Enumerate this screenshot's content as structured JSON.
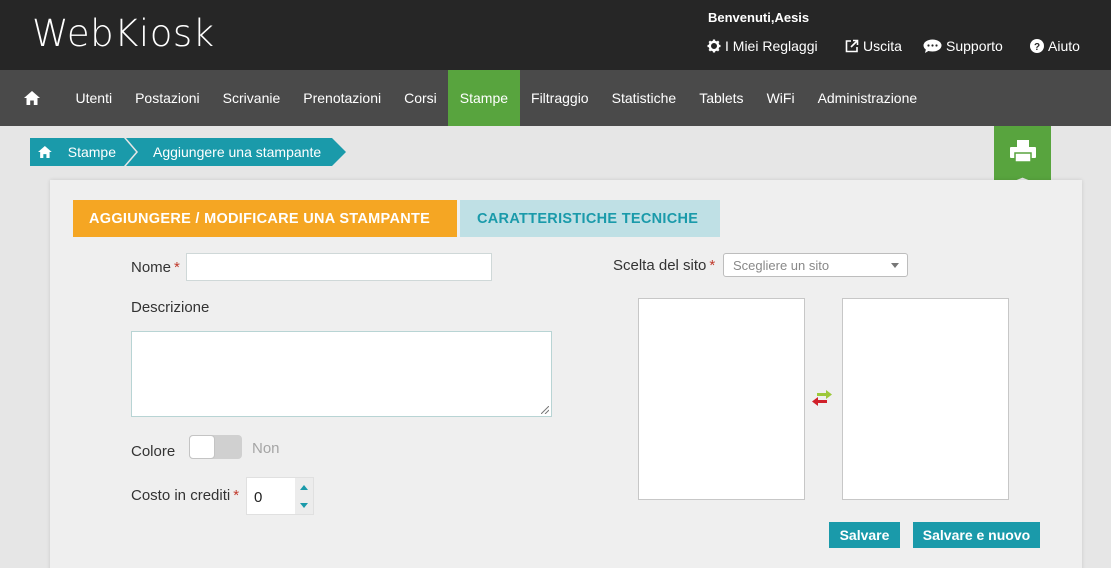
{
  "header": {
    "logo": "WebKiosk",
    "welcome": "Benvenuti,Aesis",
    "links": [
      {
        "label": "I Miei Reglaggi",
        "icon": "gear-icon"
      },
      {
        "label": "Uscita",
        "icon": "external-link-icon"
      },
      {
        "label": "Supporto",
        "icon": "chat-bubble-icon"
      },
      {
        "label": "Aiuto",
        "icon": "question-circle-icon"
      }
    ]
  },
  "nav": {
    "home_icon": "home-icon",
    "items": [
      "Utenti",
      "Postazioni",
      "Scrivanie",
      "Prenotazioni",
      "Corsi",
      "Stampe",
      "Filtraggio",
      "Statistiche",
      "Tablets",
      "WiFi",
      "Administrazione"
    ],
    "active": "Stampe"
  },
  "breadcrumb": {
    "items": [
      "Stampe",
      "Aggiungere una stampante"
    ]
  },
  "page_icon": "printer-icon",
  "tabs": {
    "active": "AGGIUNGERE / MODIFICARE UNA STAMPANTE",
    "inactive": "CARATTERISTICHE TECNICHE"
  },
  "form": {
    "name_label": "Nome",
    "name_value": "",
    "description_label": "Descrizione",
    "description_value": "",
    "color_label": "Colore",
    "color_toggle_text": "Non",
    "cost_label": "Costo in crediti",
    "cost_value": "0",
    "required_mark": "*",
    "site_label": "Scelta del sito",
    "site_placeholder": "Scegliere un sito"
  },
  "buttons": {
    "save": "Salvare",
    "save_new": "Salvare e nuovo"
  },
  "colors": {
    "header_bg": "#262626",
    "nav_bg": "#4a4a4a",
    "active_green": "#58a43e",
    "teal": "#1a9aaa",
    "orange": "#f5a623",
    "light_teal": "#bfe0e5"
  }
}
